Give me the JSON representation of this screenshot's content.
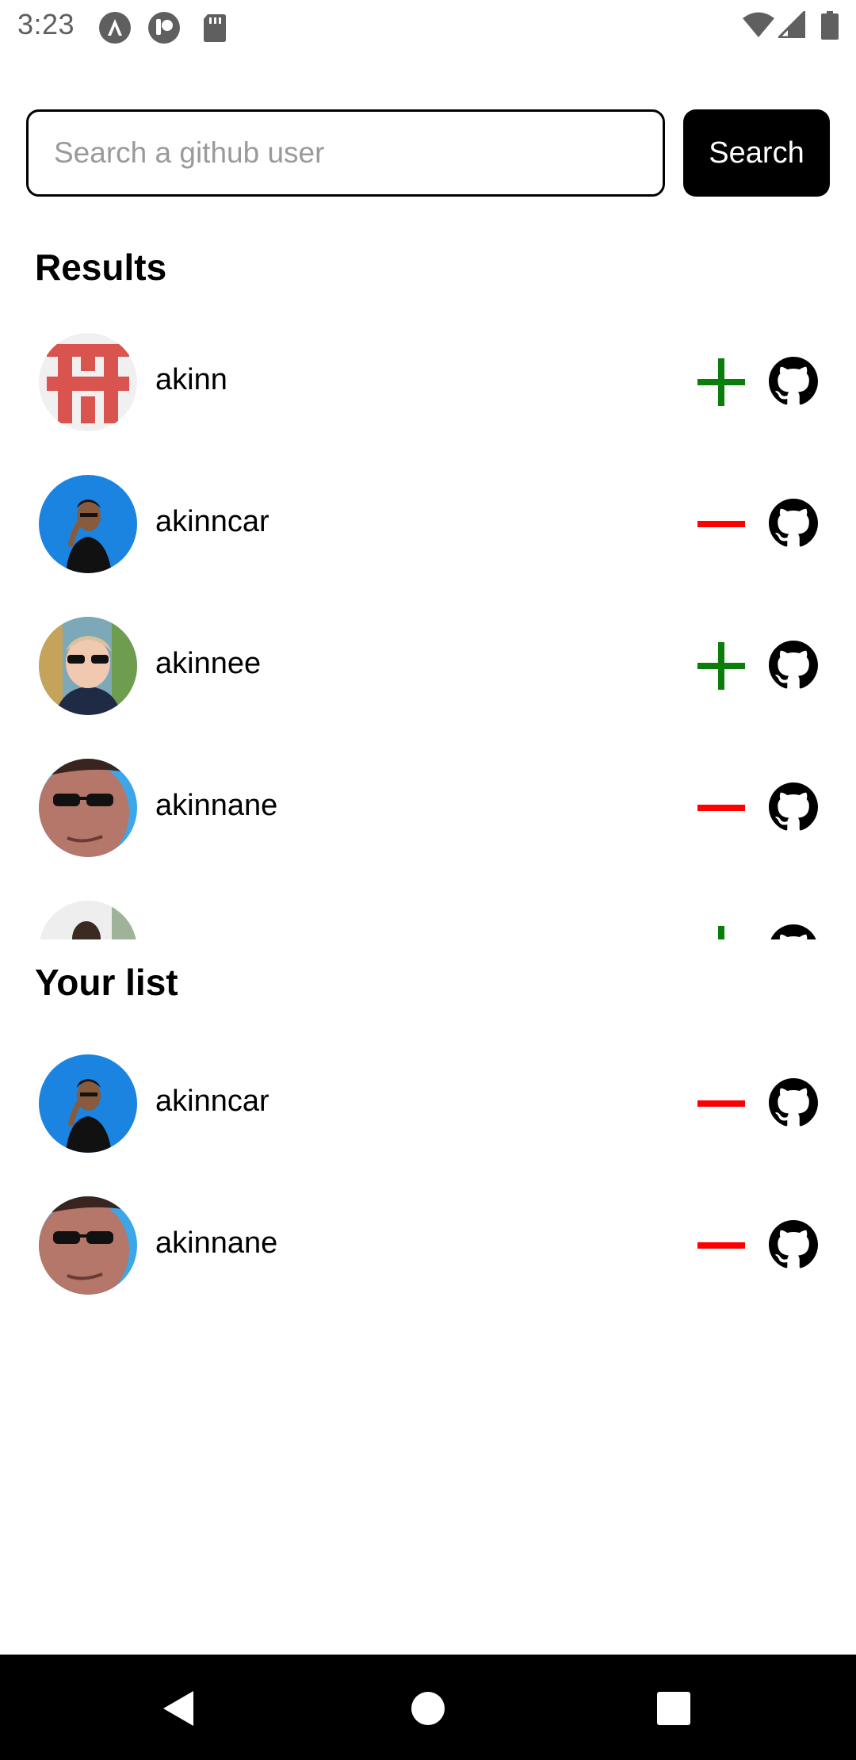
{
  "status_bar": {
    "time": "3:23",
    "icons": [
      "android-auto-icon",
      "app-notification-icon",
      "sd-card-icon",
      "wifi-icon",
      "signal-icon",
      "battery-icon"
    ]
  },
  "search": {
    "placeholder": "Search a github user",
    "value": "",
    "button_label": "Search"
  },
  "results": {
    "title": "Results",
    "items": [
      {
        "username": "akinn",
        "action": "add",
        "avatar": "red-pattern"
      },
      {
        "username": "akinncar",
        "action": "remove",
        "avatar": "blue-man"
      },
      {
        "username": "akinnee",
        "action": "add",
        "avatar": "sunglasses-man"
      },
      {
        "username": "akinnane",
        "action": "remove",
        "avatar": "closeup-man"
      },
      {
        "username": "",
        "action": "add",
        "avatar": "partial-man"
      }
    ]
  },
  "your_list": {
    "title": "Your list",
    "items": [
      {
        "username": "akinncar",
        "action": "remove",
        "avatar": "blue-man"
      },
      {
        "username": "akinnane",
        "action": "remove",
        "avatar": "closeup-man"
      }
    ]
  },
  "colors": {
    "add": "#0a7d0a",
    "remove": "#ff0000",
    "button_bg": "#000000",
    "nav_bg": "#000000"
  },
  "nav_bar": {
    "buttons": [
      "back-icon",
      "home-icon",
      "recents-icon"
    ]
  }
}
